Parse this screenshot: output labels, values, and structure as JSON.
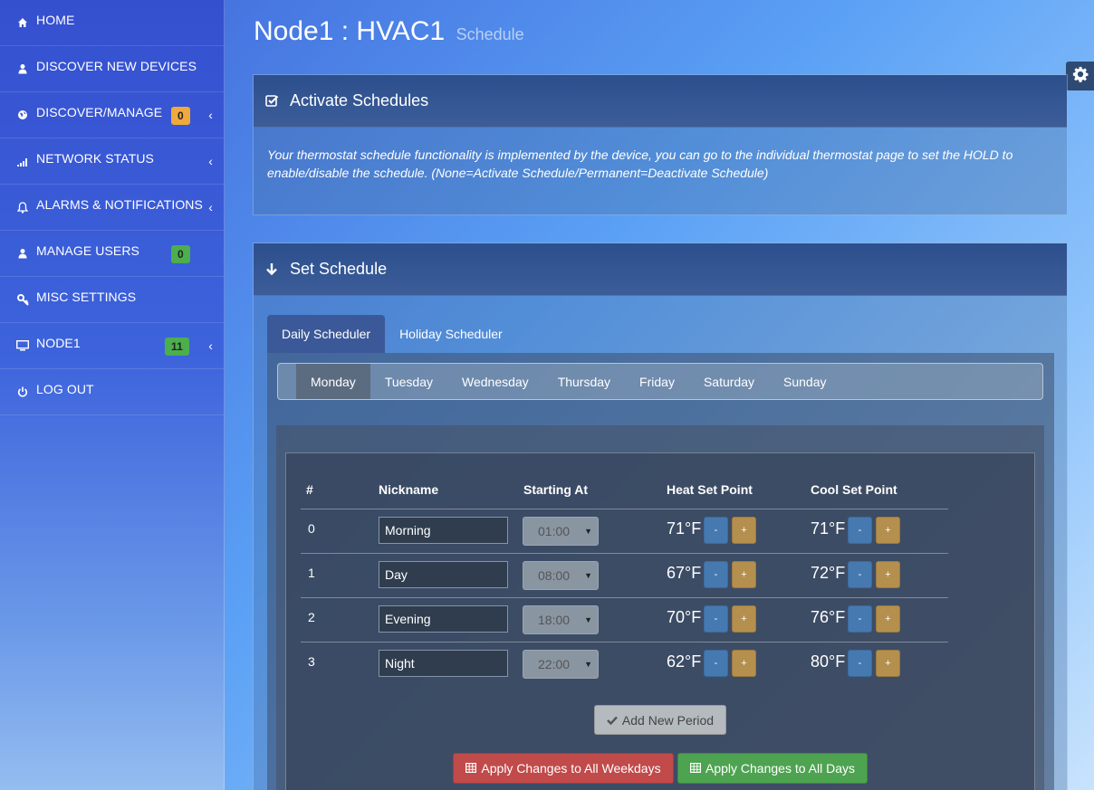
{
  "sidebar": {
    "items": [
      {
        "label": "HOME",
        "icon": "home-icon"
      },
      {
        "label": "DISCOVER NEW DEVICES",
        "icon": "user-icon"
      },
      {
        "label": "DISCOVER/MANAGE",
        "icon": "globe-icon",
        "badge": "0"
      },
      {
        "label": "NETWORK STATUS",
        "icon": "signal-icon"
      },
      {
        "label": "ALARMS & NOTIFICATIONS",
        "icon": "bell-icon"
      },
      {
        "label": "MANAGE USERS",
        "icon": "user-icon",
        "badge": "0"
      },
      {
        "label": "MISC SETTINGS",
        "icon": "key-icon"
      },
      {
        "label": "NODE1",
        "icon": "monitor-icon",
        "badge": "11"
      },
      {
        "label": "LOG OUT",
        "icon": "power-icon"
      }
    ]
  },
  "header": {
    "title": "Node1 : HVAC1",
    "subtitle": "Schedule"
  },
  "activate_panel": {
    "title": "Activate Schedules",
    "body": "Your thermostat schedule functionality is implemented by the device, you can go to the individual thermostat page to set the HOLD to enable/disable the schedule. (None=Activate Schedule/Permanent=Deactivate Schedule)"
  },
  "schedule_panel": {
    "title": "Set Schedule",
    "tabs": [
      "Daily Scheduler",
      "Holiday Scheduler"
    ],
    "days": [
      "Monday",
      "Tuesday",
      "Wednesday",
      "Thursday",
      "Friday",
      "Saturday",
      "Sunday"
    ],
    "active_day": "Monday",
    "columns": [
      "#",
      "Nickname",
      "Starting At",
      "Heat Set Point",
      "Cool Set Point"
    ],
    "rows": [
      {
        "idx": "0",
        "nickname": "Morning",
        "start": "01:00",
        "heat": "71°F",
        "cool": "71°F"
      },
      {
        "idx": "1",
        "nickname": "Day",
        "start": "08:00",
        "heat": "67°F",
        "cool": "72°F"
      },
      {
        "idx": "2",
        "nickname": "Evening",
        "start": "18:00",
        "heat": "70°F",
        "cool": "76°F"
      },
      {
        "idx": "3",
        "nickname": "Night",
        "start": "22:00",
        "heat": "62°F",
        "cool": "80°F"
      }
    ],
    "minus_label": "-",
    "plus_label": "+",
    "add_label": "Add New Period",
    "apply_weekdays_label": "Apply Changes to All Weekdays",
    "apply_all_label": "Apply Changes to All Days"
  },
  "colors": {
    "badge_orange": "#f0a93c",
    "badge_green": "#4cae4c",
    "danger": "#c14a4a",
    "success": "#4ea351"
  }
}
